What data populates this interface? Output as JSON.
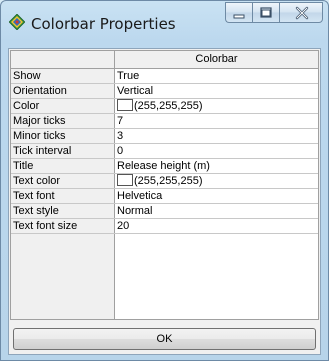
{
  "window": {
    "title": "Colorbar Properties"
  },
  "grid": {
    "column_header": "Colorbar",
    "rows": [
      {
        "label": "Show",
        "value": "True"
      },
      {
        "label": "Orientation",
        "value": "Vertical"
      },
      {
        "label": "Color",
        "value": "(255,255,255)",
        "swatch": "#ffffff"
      },
      {
        "label": "Major ticks",
        "value": "7"
      },
      {
        "label": "Minor ticks",
        "value": "3"
      },
      {
        "label": "Tick interval",
        "value": "0"
      },
      {
        "label": "Title",
        "value": "Release height (m)"
      },
      {
        "label": "Text color",
        "value": "(255,255,255)",
        "swatch": "#ffffff"
      },
      {
        "label": "Text font",
        "value": "Helvetica"
      },
      {
        "label": "Text style",
        "value": "Normal"
      },
      {
        "label": "Text font size",
        "value": "20"
      }
    ]
  },
  "buttons": {
    "ok_label": "OK"
  },
  "icons": {
    "app": "diamond-app-icon",
    "minimize": "minimize-icon",
    "maximize": "maximize-icon",
    "close": "close-icon"
  },
  "colors": {
    "swatch_color": "#ffffff",
    "frame": "#bcd8ee"
  }
}
